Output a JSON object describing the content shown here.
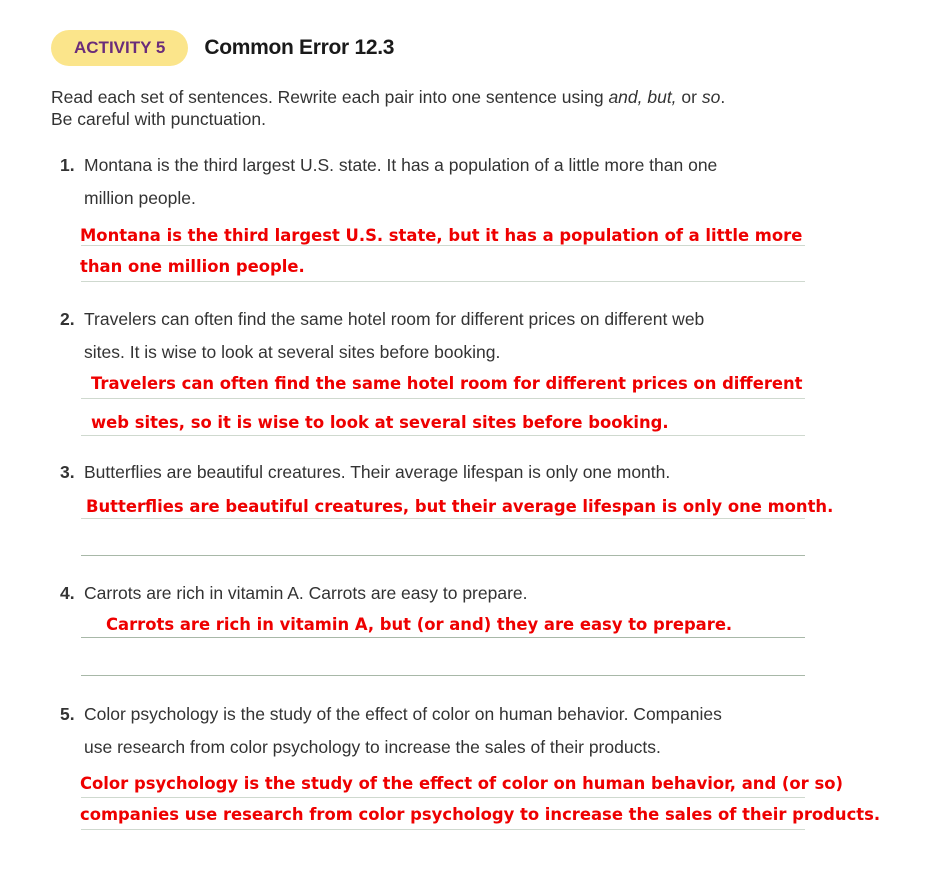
{
  "activity": {
    "label": "ACTIVITY 5",
    "title": "Common Error 12.3"
  },
  "instructions": {
    "part1": "Read each set of sentences. Rewrite each pair into one sentence using ",
    "words": "and, but,",
    "part2": " or ",
    "word_so": "so",
    "part3": ".",
    "line2": "Be careful with punctuation."
  },
  "colors": {
    "badge_bg": "#fbe58b",
    "badge_text": "#6a2c7a",
    "answer_text": "#ee0000"
  },
  "questions": [
    {
      "number": "1.",
      "lines": [
        "Montana is the third largest U.S. state. It has a population of a little more than one",
        "million people."
      ],
      "answer": [
        "Montana is the third largest U.S. state, but it has a population of a little more",
        "than one million people."
      ]
    },
    {
      "number": "2.",
      "lines": [
        "Travelers can often find the same hotel room for different prices on different web",
        "sites. It is wise to look at several sites before booking."
      ],
      "answer": [
        "Travelers can often find the same hotel room for different prices on different",
        "web sites, so it is wise to look at several sites before booking."
      ]
    },
    {
      "number": "3.",
      "lines": [
        "Butterflies are beautiful creatures. Their average lifespan is only one month."
      ],
      "answer": [
        "Butterflies are beautiful creatures, but their average lifespan is only one month."
      ]
    },
    {
      "number": "4.",
      "lines": [
        "Carrots are rich in vitamin A. Carrots are easy to prepare."
      ],
      "answer": [
        "Carrots are rich in vitamin A, but (or and) they are easy to prepare."
      ]
    },
    {
      "number": "5.",
      "lines": [
        "Color psychology is the study of the effect of color on human behavior. Companies",
        "use research from color psychology to increase the sales of their products."
      ],
      "answer": [
        "Color psychology is the study of the effect of color on human behavior, and (or so)",
        "companies use research from color psychology to increase the sales of their products."
      ]
    }
  ]
}
